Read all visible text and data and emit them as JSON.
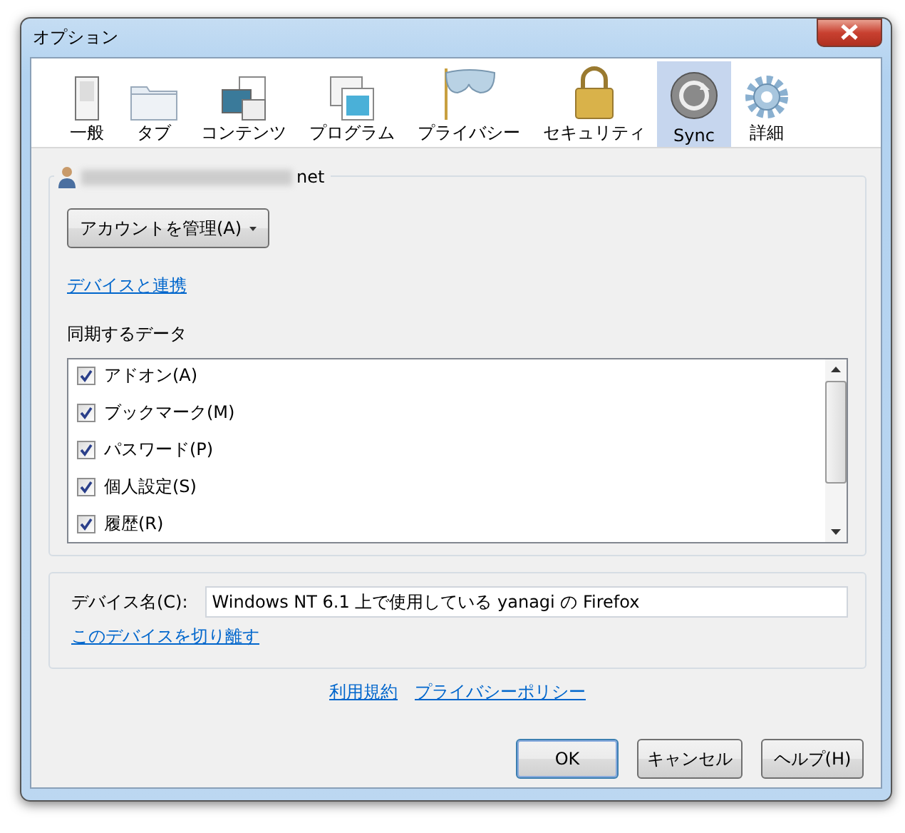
{
  "window": {
    "title": "オプション"
  },
  "tabs": [
    {
      "label": "一般",
      "selected": false
    },
    {
      "label": "タブ",
      "selected": false
    },
    {
      "label": "コンテンツ",
      "selected": false
    },
    {
      "label": "プログラム",
      "selected": false
    },
    {
      "label": "プライバシー",
      "selected": false
    },
    {
      "label": "セキュリティ",
      "selected": false
    },
    {
      "label": "Sync",
      "selected": true
    },
    {
      "label": "詳細",
      "selected": false
    }
  ],
  "account": {
    "email_visible_part": "net",
    "manage_button": "アカウントを管理(A)",
    "pair_link": "デバイスと連携"
  },
  "sync_data": {
    "heading": "同期するデータ",
    "items": [
      {
        "label": "アドオン(A)",
        "checked": true
      },
      {
        "label": "ブックマーク(M)",
        "checked": true
      },
      {
        "label": "パスワード(P)",
        "checked": true
      },
      {
        "label": "個人設定(S)",
        "checked": true
      },
      {
        "label": "履歴(R)",
        "checked": true
      }
    ]
  },
  "device": {
    "label": "デバイス名(C):",
    "value": "Windows NT 6.1 上で使用している yanagi の Firefox",
    "unlink": "このデバイスを切り離す"
  },
  "footer_links": [
    "利用規約",
    "プライバシーポリシー"
  ],
  "buttons": [
    "OK",
    "キャンセル",
    "ヘルプ(H)"
  ]
}
